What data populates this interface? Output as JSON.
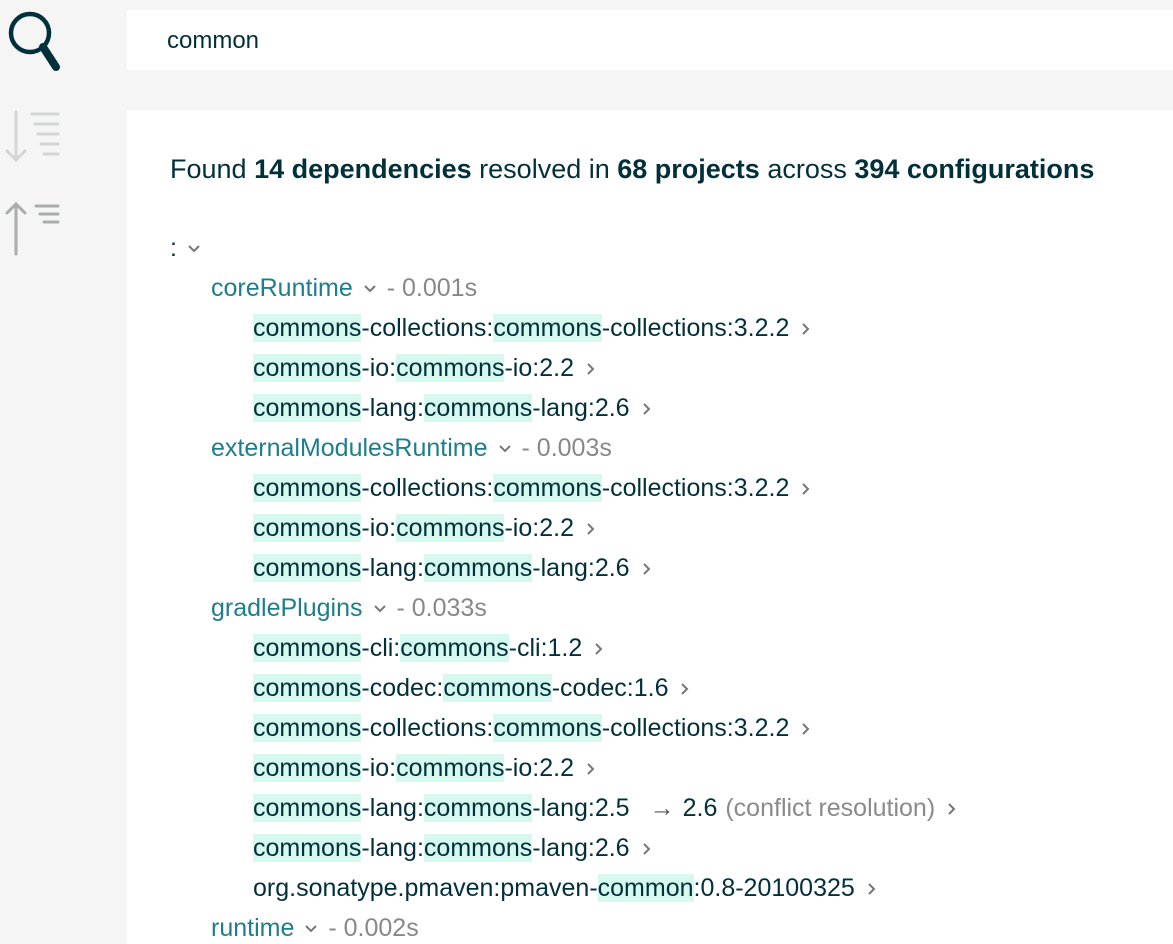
{
  "search": {
    "value": "common",
    "placeholder": ""
  },
  "summary": {
    "prefix": "Found ",
    "count_label": "14 dependencies",
    "mid1": " resolved in ",
    "projects_label": "68 projects",
    "mid2": " across ",
    "configs_label": "394 configurations"
  },
  "tree": {
    "root_label": ":",
    "configurations": [
      {
        "name": "coreRuntime",
        "time": "-  0.001s",
        "deps": [
          [
            [
              "commons",
              true
            ],
            [
              "-collections:",
              false
            ],
            [
              "commons",
              true
            ],
            [
              "-collections:3.2.2",
              false
            ]
          ],
          [
            [
              "commons",
              true
            ],
            [
              "-io:",
              false
            ],
            [
              "commons",
              true
            ],
            [
              "-io:2.2",
              false
            ]
          ],
          [
            [
              "commons",
              true
            ],
            [
              "-lang:",
              false
            ],
            [
              "commons",
              true
            ],
            [
              "-lang:2.6",
              false
            ]
          ]
        ]
      },
      {
        "name": "externalModulesRuntime",
        "time": "-  0.003s",
        "deps": [
          [
            [
              "commons",
              true
            ],
            [
              "-collections:",
              false
            ],
            [
              "commons",
              true
            ],
            [
              "-collections:3.2.2",
              false
            ]
          ],
          [
            [
              "commons",
              true
            ],
            [
              "-io:",
              false
            ],
            [
              "commons",
              true
            ],
            [
              "-io:2.2",
              false
            ]
          ],
          [
            [
              "commons",
              true
            ],
            [
              "-lang:",
              false
            ],
            [
              "commons",
              true
            ],
            [
              "-lang:2.6",
              false
            ]
          ]
        ]
      },
      {
        "name": "gradlePlugins",
        "time": "-  0.033s",
        "deps": [
          [
            [
              "commons",
              true
            ],
            [
              "-cli:",
              false
            ],
            [
              "commons",
              true
            ],
            [
              "-cli:1.2",
              false
            ]
          ],
          [
            [
              "commons",
              true
            ],
            [
              "-codec:",
              false
            ],
            [
              "commons",
              true
            ],
            [
              "-codec:1.6",
              false
            ]
          ],
          [
            [
              "commons",
              true
            ],
            [
              "-collections:",
              false
            ],
            [
              "commons",
              true
            ],
            [
              "-collections:3.2.2",
              false
            ]
          ],
          [
            [
              "commons",
              true
            ],
            [
              "-io:",
              false
            ],
            [
              "commons",
              true
            ],
            [
              "-io:2.2",
              false
            ]
          ],
          {
            "parts": [
              [
                "commons",
                true
              ],
              [
                "-lang:",
                false
              ],
              [
                "commons",
                true
              ],
              [
                "-lang:2.5",
                false
              ]
            ],
            "arrow": "→",
            "resolved": "2.6",
            "reason": "(conflict resolution)"
          },
          [
            [
              "commons",
              true
            ],
            [
              "-lang:",
              false
            ],
            [
              "commons",
              true
            ],
            [
              "-lang:2.6",
              false
            ]
          ],
          [
            [
              "org.sonatype.pmaven:pmaven-",
              false
            ],
            [
              "common",
              true
            ],
            [
              ":0.8-20100325",
              false
            ]
          ]
        ]
      },
      {
        "name": "runtime",
        "time": "-  0.002s",
        "deps": []
      }
    ]
  },
  "icons": {
    "search": "search-icon",
    "sort_descending": "sort-descending-icon",
    "sort_ascending": "sort-ascending-icon"
  },
  "colors": {
    "highlight": "#d5f9ef",
    "configuration": "#1e7e8c",
    "text": "#02303a",
    "muted": "#888888"
  }
}
